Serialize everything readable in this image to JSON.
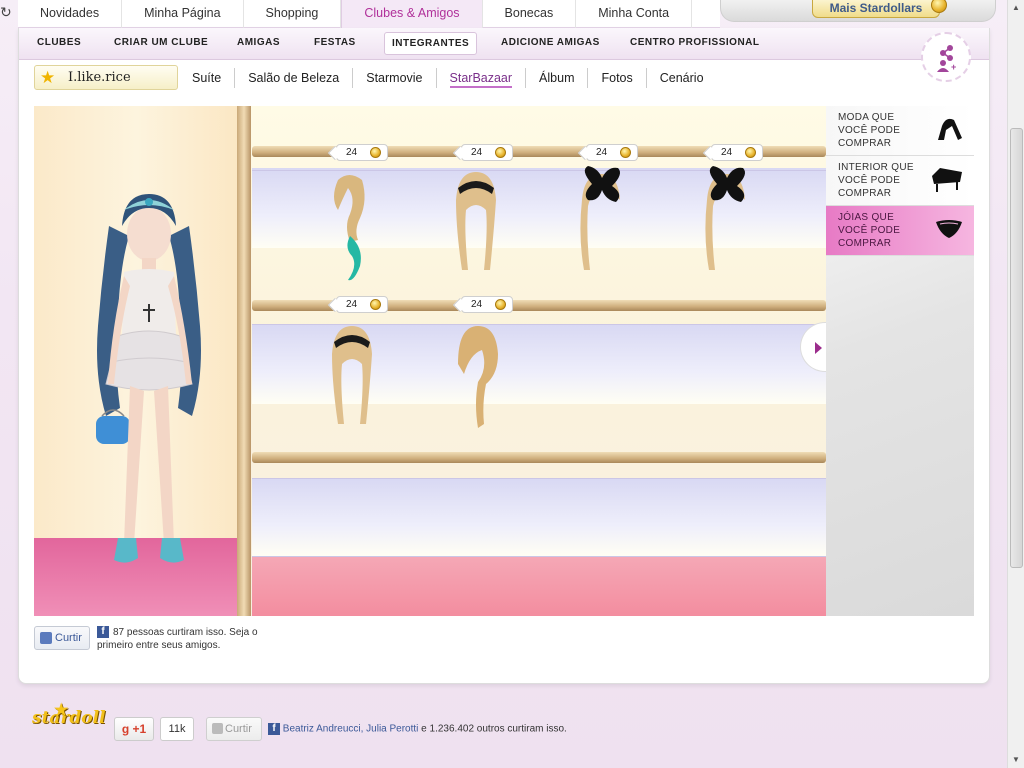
{
  "top_nav": {
    "tabs": [
      "Novidades",
      "Minha Página",
      "Shopping",
      "Clubes & Amigos",
      "Bonecas",
      "Minha Conta"
    ],
    "active": "Clubes & Amigos"
  },
  "stardollars_button": "Mais Stardollars",
  "sub_nav": {
    "items": [
      "CLUBES",
      "CRIAR UM CLUBE",
      "AMIGAS",
      "FESTAS",
      "INTEGRANTES",
      "ADICIONE AMIGAS",
      "CENTRO PROFISSIONAL"
    ],
    "active": "INTEGRANTES"
  },
  "profile": {
    "username": "I.like.rice",
    "tabs": [
      "Suíte",
      "Salão de Beleza",
      "Starmovie",
      "StarBazaar",
      "Álbum",
      "Fotos",
      "Cenário"
    ],
    "active_tab": "StarBazaar"
  },
  "shop_menu": {
    "items": [
      {
        "label": "MODA QUE VOCÊ PODE COMPRAR",
        "icon": "shoe-icon"
      },
      {
        "label": "INTERIOR QUE VOCÊ PODE COMPRAR",
        "icon": "piano-icon"
      },
      {
        "label": "JÓIAS QUE VOCÊ PODE COMPRAR",
        "icon": "jewel-icon"
      }
    ],
    "active_index": 2
  },
  "shelf_items": [
    {
      "price": "24",
      "hair": "blonde-teal-wavy"
    },
    {
      "price": "24",
      "hair": "blonde-braid-black-headband"
    },
    {
      "price": "24",
      "hair": "blonde-black-bow"
    },
    {
      "price": "24",
      "hair": "blonde-black-bow"
    },
    {
      "price": "24",
      "hair": "blonde-braid-black-headband"
    },
    {
      "price": "24",
      "hair": "blonde-side-braid"
    }
  ],
  "like_section": {
    "button": "Curtir",
    "text_line1": "87 pessoas curtiram isso. Seja o",
    "text_line2": "primeiro entre seus amigos."
  },
  "footer": {
    "logo": "stardoll",
    "gplus_label": "+1",
    "gplus_count": "11k",
    "curtir": "Curtir",
    "friends": "Beatriz Andreucci, Julia Perotti",
    "rest": " e 1.236.402 outros curtiram isso."
  },
  "colors": {
    "accent_pink": "#b0309a",
    "active_shop": "#e77ac5",
    "coin": "#e7b22a",
    "facebook": "#3b5998"
  }
}
